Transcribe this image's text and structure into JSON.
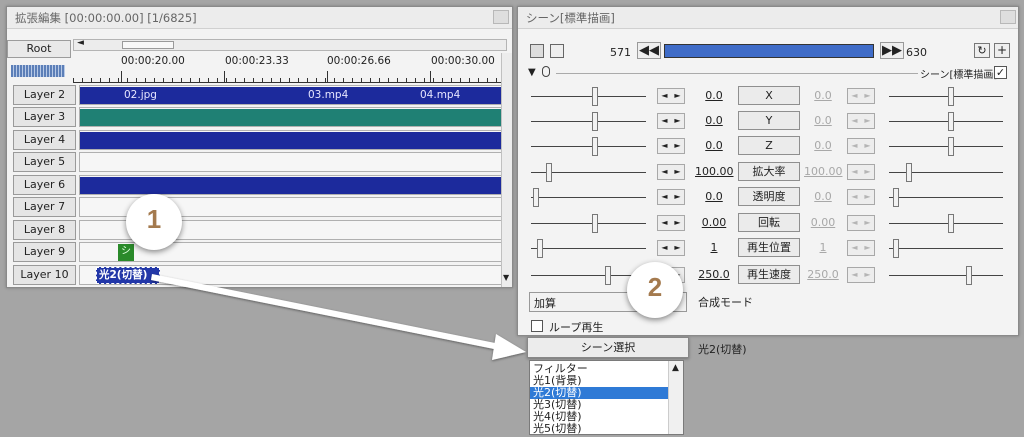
{
  "timeline": {
    "title": "拡張編集 [00:00:00.00] [1/6825]",
    "root_label": "Root",
    "timecodes": [
      "00:00:20.00",
      "00:00:23.33",
      "00:00:26.66",
      "00:00:30.00"
    ],
    "layers": [
      {
        "label": "Layer 2",
        "clips": [
          "02.jpg",
          "03.mp4",
          "04.mp4"
        ]
      },
      {
        "label": "Layer 3"
      },
      {
        "label": "Layer 4"
      },
      {
        "label": "Layer 5"
      },
      {
        "label": "Layer 6"
      },
      {
        "label": "Layer 7"
      },
      {
        "label": "Layer 8"
      },
      {
        "label": "Layer 9",
        "clip_icon": "シ"
      },
      {
        "label": "Layer 10",
        "clip": "光2(切替)"
      }
    ]
  },
  "scene": {
    "title": "シーン[標準描画]",
    "frame_start": "571",
    "frame_end": "630",
    "filter_label": "シーン[標準描画]",
    "params": [
      {
        "label": "X",
        "value": "0.0",
        "end_value": "0.0"
      },
      {
        "label": "Y",
        "value": "0.0",
        "end_value": "0.0"
      },
      {
        "label": "Z",
        "value": "0.0",
        "end_value": "0.0"
      },
      {
        "label": "拡大率",
        "value": "100.00",
        "end_value": "100.00"
      },
      {
        "label": "透明度",
        "value": "0.0",
        "end_value": "0.0"
      },
      {
        "label": "回転",
        "value": "0.00",
        "end_value": "0.00"
      },
      {
        "label": "再生位置",
        "value": "1",
        "end_value": "1"
      },
      {
        "label": "再生速度",
        "value": "250.0",
        "end_value": "250.0"
      }
    ],
    "blend_select": "加算",
    "blend_label": "合成モード",
    "loop_label": "ループ再生",
    "scene_select_button": "シーン選択",
    "scene_select_value": "光2(切替)",
    "dropdown_items": [
      "フィルター",
      "光1(背景)",
      "光2(切替)",
      "光3(切替)",
      "光4(切替)",
      "光5(切替)"
    ],
    "dropdown_selected": "光2(切替)"
  },
  "callouts": {
    "first": "1",
    "second": "2"
  },
  "colors": {
    "clip_blue": "#1c2a9c",
    "clip_teal": "#1f8074",
    "selection": "#2f7ad6",
    "callout_digit": "#a47a4e"
  }
}
